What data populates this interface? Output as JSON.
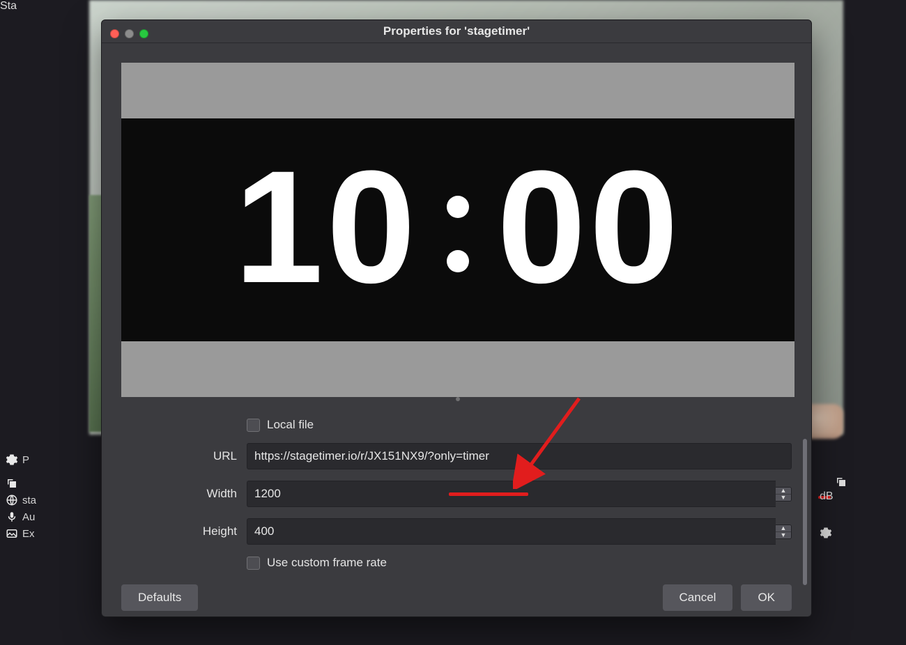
{
  "window": {
    "title": "Properties for 'stagetimer'"
  },
  "preview": {
    "timer": "10:00",
    "timer_left": "10",
    "timer_right": "00"
  },
  "form": {
    "local_file_label": "Local file",
    "url_label": "URL",
    "url_value": "https://stagetimer.io/r/JX151NX9/?only=timer",
    "width_label": "Width",
    "width_value": "1200",
    "height_label": "Height",
    "height_value": "400",
    "custom_framerate_label": "Use custom frame rate"
  },
  "buttons": {
    "defaults": "Defaults",
    "cancel": "Cancel",
    "ok": "OK"
  },
  "left_panel": {
    "header_char": "P",
    "items": [
      {
        "icon": "globe",
        "label": "sta"
      },
      {
        "icon": "mic",
        "label": "Au"
      },
      {
        "icon": "image",
        "label": "Ex"
      }
    ]
  },
  "right_panel": {
    "db_label": "dB",
    "start_label": "Sta"
  }
}
